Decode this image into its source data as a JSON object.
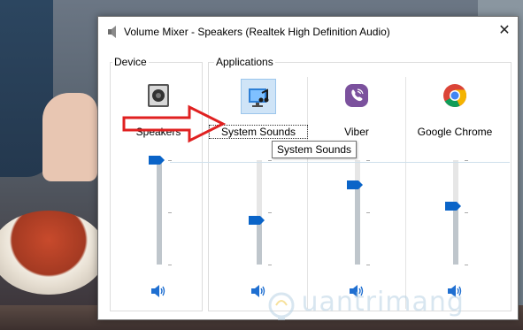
{
  "window": {
    "title": "Volume Mixer - Speakers (Realtek High Definition Audio)",
    "close_glyph": "✕"
  },
  "groups": {
    "device_label": "Device",
    "applications_label": "Applications"
  },
  "channels": [
    {
      "id": "speakers",
      "label": "Speakers",
      "icon": "speaker-device-icon",
      "level": 1.0
    },
    {
      "id": "system-sounds",
      "label": "System Sounds",
      "icon": "system-sounds-icon",
      "level": 0.42
    },
    {
      "id": "viber",
      "label": "Viber",
      "icon": "viber-icon",
      "level": 0.76
    },
    {
      "id": "google-chrome",
      "label": "Google Chrome",
      "icon": "chrome-icon",
      "level": 0.56
    }
  ],
  "tooltip": "System Sounds",
  "watermark": "uantrimang",
  "colors": {
    "thumb": "#0a64c8",
    "annotation_arrow": "#e02020",
    "viber": "#7b519d"
  }
}
